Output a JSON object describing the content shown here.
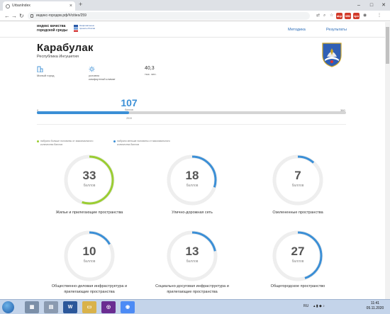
{
  "browser": {
    "tab_title": "UrbanIndex",
    "url": "индекс-городов.рф/#/cities/259",
    "extensions": [
      {
        "name": "ext-red-1",
        "color": "#d23b2b",
        "text": "abp"
      },
      {
        "name": "ext-red-2",
        "color": "#d23b2b",
        "text": "MM"
      },
      {
        "name": "ext-red-3",
        "color": "#d23b2b",
        "text": "vpn"
      }
    ]
  },
  "site": {
    "logo_text": "индекс качества городской среды",
    "logo_sub": "Национальные проекты России",
    "nav": [
      "Методика",
      "Результаты"
    ]
  },
  "city": {
    "name": "Карабулак",
    "region": "Республика Ингушетия"
  },
  "facts": {
    "size_label": "Малый город",
    "climate_label": "условно комфортный климат",
    "population_value": "40,3",
    "population_unit": "тыс. чел."
  },
  "total": {
    "score": "107",
    "unit": "баллов",
    "scale_min": "0",
    "scale_max": "360",
    "year": "2019",
    "progress_fraction": 0.2972
  },
  "legend": [
    {
      "text": "набрано больше половины от максимального количества баллов",
      "color": "#9acd32"
    },
    {
      "text": "набрано меньше половины от максимального количества баллов",
      "color": "#3b8fd6"
    }
  ],
  "categories": [
    {
      "label": "Жилье и прилегающие пространства",
      "score": "33",
      "unit": "баллов",
      "fraction": 0.55,
      "color": "#9acd32"
    },
    {
      "label": "Улично-дорожная сеть",
      "score": "18",
      "unit": "баллов",
      "fraction": 0.3,
      "color": "#3b8fd6"
    },
    {
      "label": "Озелененные пространства",
      "score": "7",
      "unit": "баллов",
      "fraction": 0.117,
      "color": "#3b8fd6"
    },
    {
      "label": "Общественно-деловая инфраструктура и прилегающие пространства",
      "score": "10",
      "unit": "баллов",
      "fraction": 0.167,
      "color": "#3b8fd6"
    },
    {
      "label": "Социально-досуговая инфраструктура и прилегающие пространства",
      "score": "13",
      "unit": "баллов",
      "fraction": 0.217,
      "color": "#3b8fd6"
    },
    {
      "label": "Общегородское пространство",
      "score": "27",
      "unit": "баллов",
      "fraction": 0.45,
      "color": "#3b8fd6"
    }
  ],
  "taskbar": {
    "lang": "RU",
    "time": "11:41",
    "date": "05.11.2020"
  }
}
